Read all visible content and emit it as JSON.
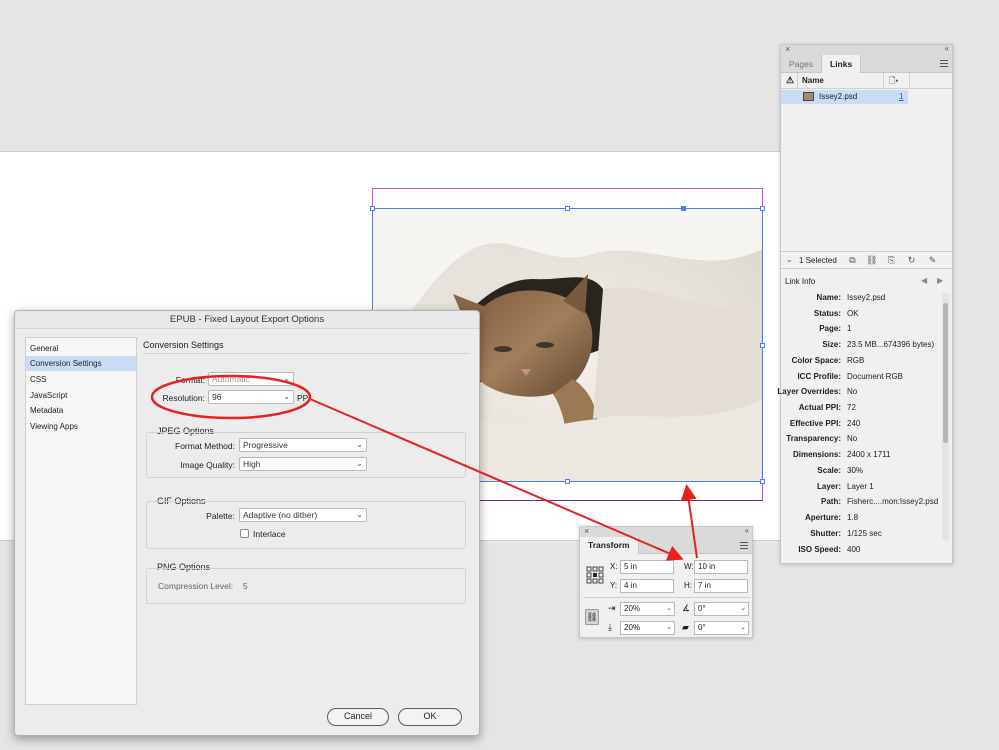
{
  "colors": {
    "accent_blue": "#4a7ee8",
    "frame_magenta": "#d24ad2",
    "annotation_red": "#e8211f",
    "selection": "#c9dcf4"
  },
  "links_panel": {
    "tabs": [
      "Pages",
      "Links"
    ],
    "active_tab": "Links",
    "column_name": "Name",
    "link_name": "Issey2.psd",
    "link_page": "1",
    "selected_count": "1 Selected",
    "info_header": "Link Info",
    "info": [
      {
        "key": "Name:",
        "value": "Issey2.psd"
      },
      {
        "key": "Status:",
        "value": "OK"
      },
      {
        "key": "Page:",
        "value": "1"
      },
      {
        "key": "Size:",
        "value": "23.5 MB...674396 bytes)"
      },
      {
        "key": "Color Space:",
        "value": "RGB"
      },
      {
        "key": "ICC Profile:",
        "value": "Document RGB"
      },
      {
        "key": "Layer Overrides:",
        "value": "No"
      },
      {
        "key": "Actual PPI:",
        "value": "72"
      },
      {
        "key": "Effective PPI:",
        "value": "240"
      },
      {
        "key": "Transparency:",
        "value": "No"
      },
      {
        "key": "Dimensions:",
        "value": "2400 x 1711"
      },
      {
        "key": "Scale:",
        "value": "30%"
      },
      {
        "key": "Layer:",
        "value": "Layer 1"
      },
      {
        "key": "Path:",
        "value": "Fisherc....mon:Issey2.psd"
      },
      {
        "key": "Aperture:",
        "value": "1.8"
      },
      {
        "key": "Shutter:",
        "value": "1/125 sec"
      },
      {
        "key": "ISO Speed:",
        "value": "400"
      }
    ]
  },
  "transform_panel": {
    "title": "Transform",
    "x_label": "X:",
    "x_value": "5 in",
    "y_label": "Y:",
    "y_value": "4 in",
    "w_label": "W:",
    "w_value": "10 in",
    "h_label": "H:",
    "h_value": "7 in",
    "scale_x": "20%",
    "scale_y": "20%",
    "rotate": "0°",
    "shear": "0°"
  },
  "dialog": {
    "title": "EPUB - Fixed Layout Export Options",
    "sidebar": [
      "General",
      "Conversion Settings",
      "CSS",
      "JavaScript",
      "Metadata",
      "Viewing Apps"
    ],
    "selected_sidebar": "Conversion Settings",
    "section_title": "Conversion Settings",
    "format_label": "Format:",
    "format_value": "Automatic",
    "resolution_label": "Resolution:",
    "resolution_value": "96",
    "resolution_unit": "PPI",
    "jpeg_title": "JPEG Options",
    "format_method_label": "Format Method:",
    "format_method_value": "Progressive",
    "image_quality_label": "Image Quality:",
    "image_quality_value": "High",
    "gif_title": "GIF Options",
    "palette_label": "Palette:",
    "palette_value": "Adaptive (no dither)",
    "interlace_label": "Interlace",
    "interlace_checked": false,
    "png_title": "PNG Options",
    "compression_label": "Compression Level:",
    "compression_value": "5",
    "cancel_label": "Cancel",
    "ok_label": "OK"
  }
}
